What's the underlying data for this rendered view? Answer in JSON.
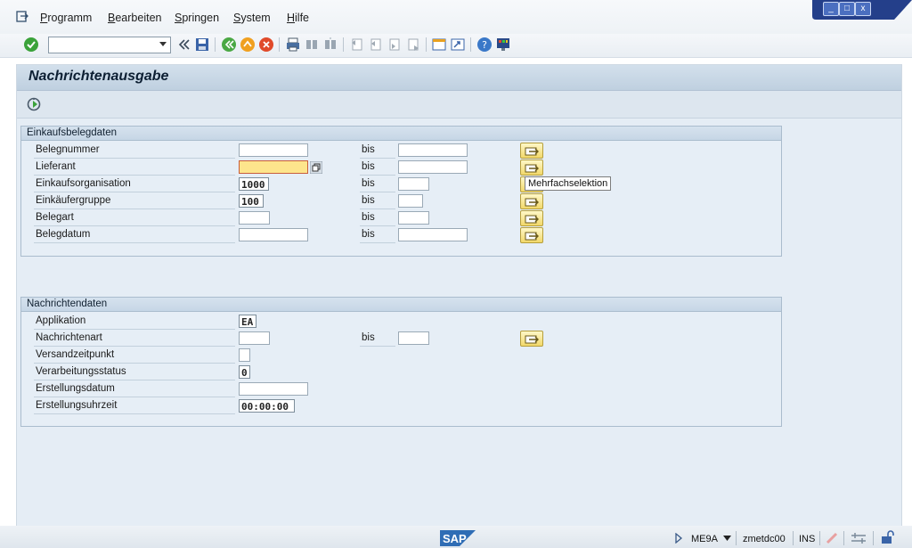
{
  "menu": {
    "items": [
      {
        "label": "Programm",
        "accel": "P",
        "rest": "rogramm"
      },
      {
        "label": "Bearbeiten",
        "accel": "B",
        "rest": "earbeiten"
      },
      {
        "label": "Springen",
        "accel": "S",
        "rest": "pringen"
      },
      {
        "label": "System",
        "accel": "S",
        "rest": "ystem"
      },
      {
        "label": "Hilfe",
        "accel": "H",
        "rest": "ilfe"
      }
    ]
  },
  "window_controls": {
    "minimize": "_",
    "maximize": "□",
    "close": "x"
  },
  "toolbar": {
    "command_field_value": "",
    "icons": [
      "enter-check-icon",
      "back-chevron-icon",
      "save-icon",
      "back-icon",
      "exit-icon",
      "cancel-icon",
      "print-icon",
      "find-icon",
      "find-next-icon",
      "first-page-icon",
      "prev-page-icon",
      "next-page-icon",
      "last-page-icon",
      "new-session-icon",
      "shortcut-icon",
      "help-icon",
      "customize-layout-icon"
    ]
  },
  "page": {
    "title": "Nachrichtenausgabe",
    "execute_icon": "execute-icon"
  },
  "einkauf": {
    "title": "Einkaufsbelegdaten",
    "rows": [
      {
        "label": "Belegnummer",
        "from": "",
        "bis": "bis",
        "to": ""
      },
      {
        "label": "Lieferant",
        "from": "",
        "bis": "bis",
        "to": ""
      },
      {
        "label": "Einkaufsorganisation",
        "from": "1000",
        "bis": "bis",
        "to": ""
      },
      {
        "label": "Einkäufergruppe",
        "from": "100",
        "bis": "bis",
        "to": ""
      },
      {
        "label": "Belegart",
        "from": "",
        "bis": "bis",
        "to": ""
      },
      {
        "label": "Belegdatum",
        "from": "",
        "bis": "bis",
        "to": ""
      }
    ],
    "tooltip": "Mehrfachselektion"
  },
  "nachricht": {
    "title": "Nachrichtendaten",
    "rows": [
      {
        "label": "Applikation",
        "value": "EA"
      },
      {
        "label": "Nachrichtenart",
        "value": "",
        "bis": "bis",
        "to": ""
      },
      {
        "label": "Versandzeitpunkt",
        "value": ""
      },
      {
        "label": "Verarbeitungsstatus",
        "value": "0"
      },
      {
        "label": "Erstellungsdatum",
        "value": ""
      },
      {
        "label": "Erstellungsuhrzeit",
        "value": "00:00:00"
      }
    ]
  },
  "status": {
    "logo": "SAP",
    "transaction": "ME9A",
    "server": "zmetdc00",
    "mode": "INS"
  },
  "colors": {
    "accent": "#2f6db5",
    "multiselect": "#f2d86a",
    "focus_field": "#fde58c"
  }
}
